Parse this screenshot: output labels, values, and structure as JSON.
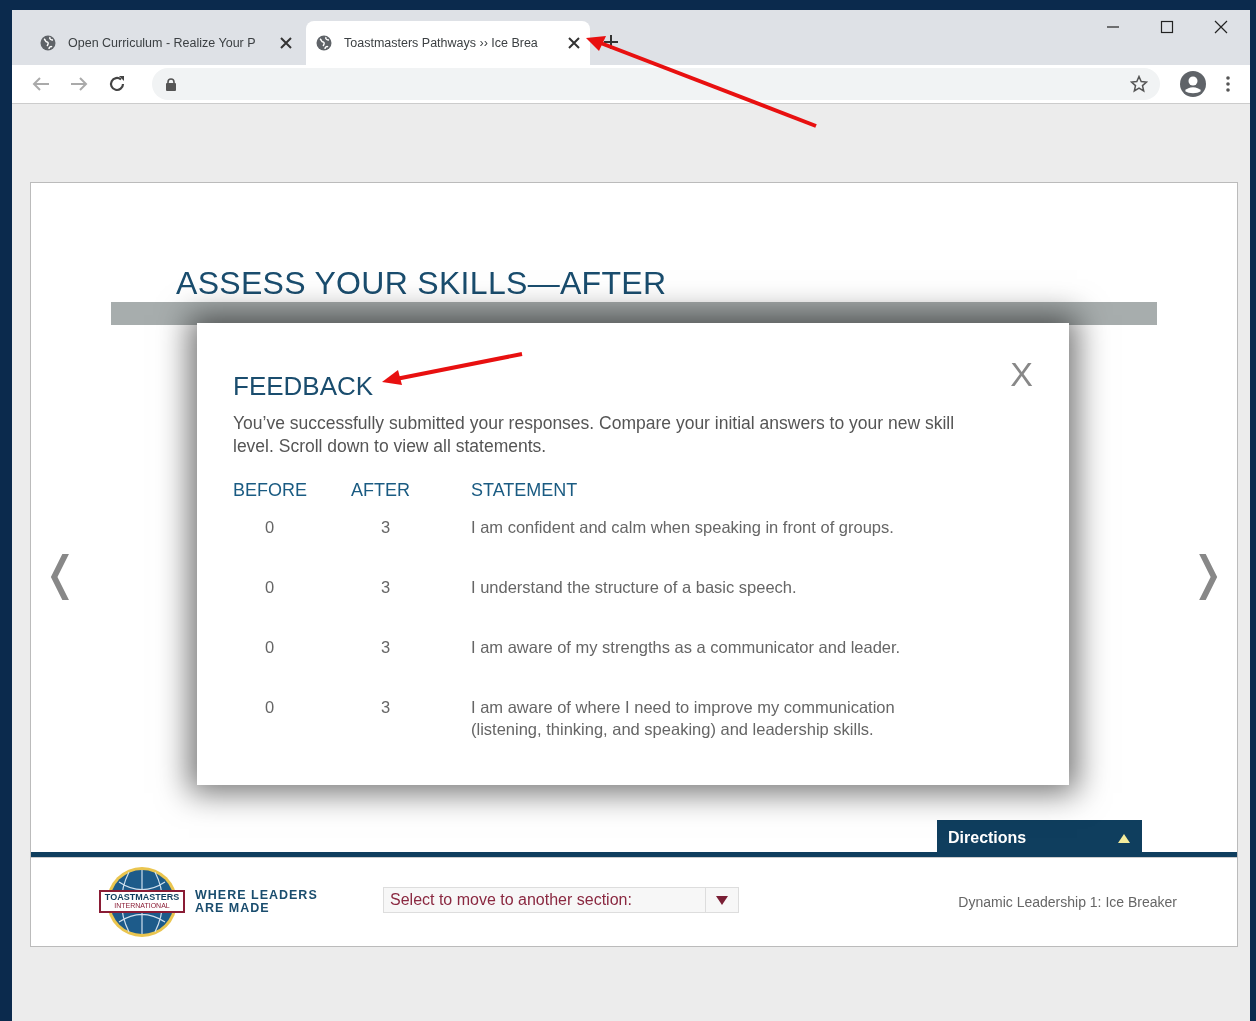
{
  "browser": {
    "tabs": [
      {
        "title": "Open Curriculum - Realize Your P",
        "selected": false
      },
      {
        "title": "Toastmasters Pathways ›› Ice Brea",
        "selected": true
      }
    ]
  },
  "page": {
    "title": "ASSESS YOUR SKILLS—AFTER",
    "prev_arrow": "❬",
    "next_arrow": "❭"
  },
  "dialog": {
    "title": "FEEDBACK",
    "close": "X",
    "message": "You’ve successfully submitted your responses. Compare your initial answers to your new skill level. Scroll down to view all statements.",
    "columns": [
      "BEFORE",
      "AFTER",
      "STATEMENT"
    ],
    "rows": [
      {
        "before": "0",
        "after": "3",
        "statement": "I am confident and calm when speaking in front of groups."
      },
      {
        "before": "0",
        "after": "3",
        "statement": "I understand the structure of a basic speech."
      },
      {
        "before": "0",
        "after": "3",
        "statement": "I am aware of my strengths as a communicator and leader."
      },
      {
        "before": "0",
        "after": "3",
        "statement": "I am aware of where I need to improve my communication (listening, thinking, and speaking) and leadership skills."
      }
    ]
  },
  "directions": {
    "label": "Directions"
  },
  "footer": {
    "logo_text": "TOASTMASTERS",
    "logo_subtext": "INTERNATIONAL",
    "tagline": [
      "WHERE LEADERS",
      "ARE MADE"
    ],
    "section_select": {
      "placeholder": "Select to move to another section:"
    },
    "course": "Dynamic Leadership 1: Ice Breaker"
  }
}
